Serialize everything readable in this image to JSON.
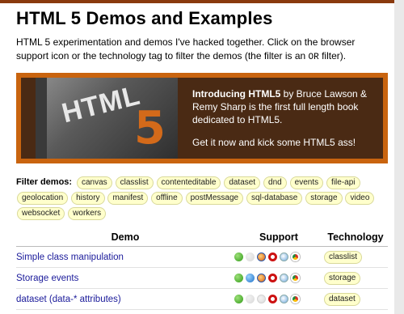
{
  "header": {
    "title": "HTML 5 Demos and Examples"
  },
  "intro": {
    "text_a": "HTML 5 experimentation and demos I've hacked together. Click on the browser support icon or the technology tag to filter the demos (the filter is an ",
    "code": "OR",
    "text_b": " filter)."
  },
  "promo": {
    "book_title": "HTML",
    "book_number": "5",
    "book_title_strong": "Introducing HTML5",
    "line1_rest": " by Bruce Lawson & Remy Sharp is the first full length book dedicated to HTML5.",
    "line2": "Get it now and kick some HTML5 ass!"
  },
  "filters": {
    "label": "Filter demos:",
    "tags": [
      "canvas",
      "classlist",
      "contenteditable",
      "dataset",
      "dnd",
      "events",
      "file-api",
      "geolocation",
      "history",
      "manifest",
      "offline",
      "postMessage",
      "sql-database",
      "storage",
      "video",
      "websocket",
      "workers"
    ]
  },
  "table": {
    "headers": {
      "demo": "Demo",
      "support": "Support",
      "technology": "Technology"
    },
    "rows": [
      {
        "name": "Simple class manipulation",
        "tag": "classlist",
        "support": [
          "supported",
          "ie-off",
          "firefox",
          "opera",
          "safari",
          "chrome"
        ]
      },
      {
        "name": "Storage events",
        "tag": "storage",
        "support": [
          "supported",
          "ie",
          "firefox",
          "opera",
          "safari",
          "chrome"
        ]
      },
      {
        "name": "dataset (data-* attributes)",
        "tag": "dataset",
        "support": [
          "supported",
          "ie-off",
          "firefox-off",
          "opera",
          "safari",
          "chrome"
        ]
      }
    ]
  },
  "icons": {
    "supported": "green-check-icon",
    "ie": "internet-explorer-icon",
    "firefox": "firefox-icon",
    "opera": "opera-icon",
    "safari": "safari-icon",
    "chrome": "chrome-icon"
  }
}
